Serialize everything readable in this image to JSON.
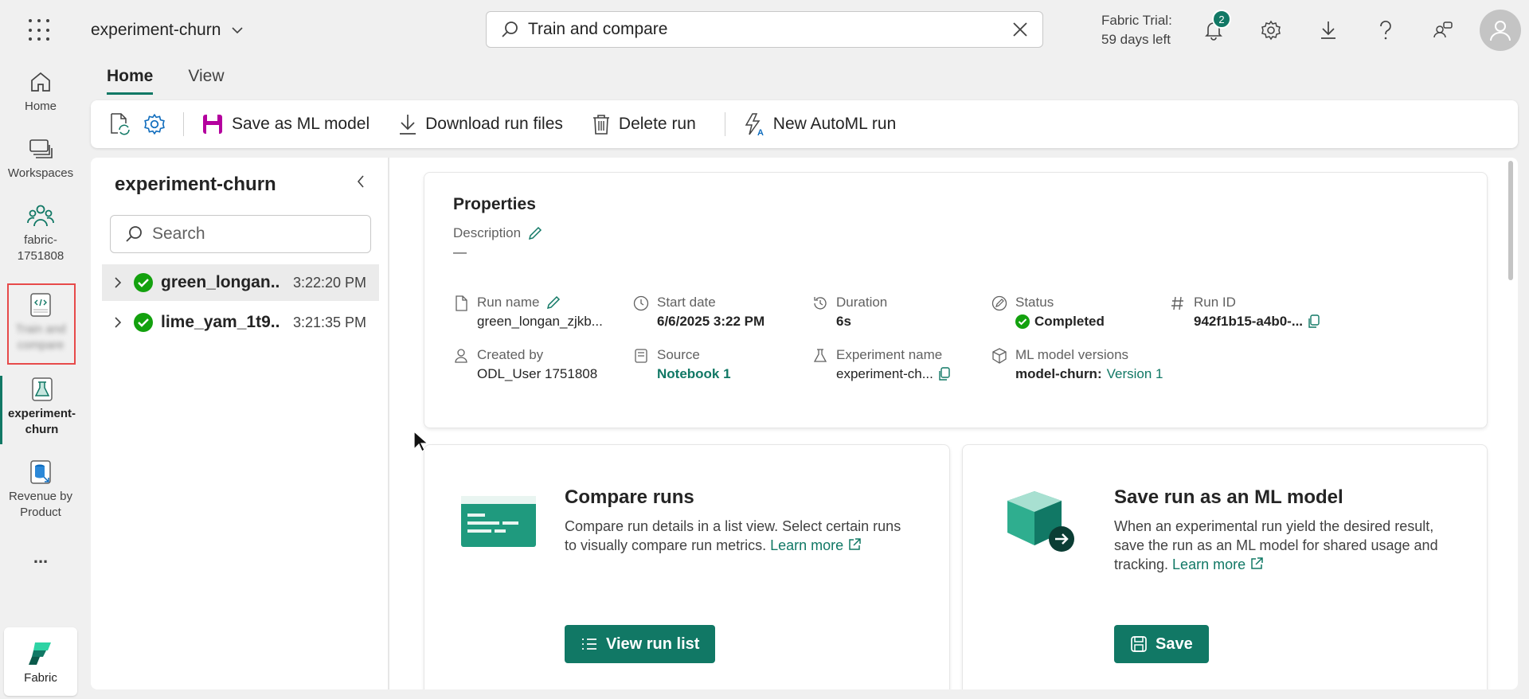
{
  "header": {
    "workspace_title": "experiment-churn",
    "search_value": "Train and compare",
    "trial_line1": "Fabric Trial:",
    "trial_line2": "59 days left",
    "notification_count": "2"
  },
  "leftnav": {
    "items": [
      {
        "label": "Home"
      },
      {
        "label": "Workspaces"
      },
      {
        "label": "fabric-1751808"
      },
      {
        "label": "Train and compare"
      },
      {
        "label": "experiment-churn"
      },
      {
        "label": "Revenue by Product"
      }
    ],
    "more": "...",
    "fabric_label": "Fabric"
  },
  "tabs": [
    {
      "label": "Home"
    },
    {
      "label": "View"
    }
  ],
  "toolbar": {
    "save_ml_model": "Save as ML model",
    "download_run_files": "Download run files",
    "delete_run": "Delete run",
    "new_automl_run": "New AutoML run"
  },
  "runs_panel": {
    "title": "experiment-churn",
    "search_placeholder": "Search",
    "runs": [
      {
        "name": "green_longan...",
        "time": "3:22:20 PM",
        "selected": true
      },
      {
        "name": "lime_yam_1t9...",
        "time": "3:21:35 PM",
        "selected": false
      }
    ]
  },
  "properties": {
    "title": "Properties",
    "description_label": "Description",
    "description_value": "—",
    "run_name_label": "Run name",
    "run_name": "green_longan_zjkb...",
    "start_date_label": "Start date",
    "start_date": "6/6/2025 3:22 PM",
    "duration_label": "Duration",
    "duration": "6s",
    "status_label": "Status",
    "status": "Completed",
    "run_id_label": "Run ID",
    "run_id": "942f1b15-a4b0-...",
    "created_by_label": "Created by",
    "created_by": "ODL_User 1751808",
    "source_label": "Source",
    "source": "Notebook 1",
    "experiment_name_label": "Experiment name",
    "experiment_name": "experiment-ch...",
    "ml_versions_label": "ML model versions",
    "ml_model_name": "model-churn:",
    "ml_model_version": "Version 1"
  },
  "compare_card": {
    "title": "Compare runs",
    "desc_line1": "Compare run details in a list view. Select certain runs",
    "desc_line2": "to visually compare run metrics.",
    "learn_more": "Learn more",
    "button": "View run list"
  },
  "save_card": {
    "title": "Save run as an ML model",
    "desc_line1": "When an experimental run yield the desired result,",
    "desc_line2": "save the run as an ML model for shared usage and",
    "desc_line3": "tracking.",
    "learn_more": "Learn more",
    "button": "Save"
  },
  "colors": {
    "accent": "#117865",
    "highlight_box": "#e74a4a",
    "status_ok": "#13a10e"
  }
}
